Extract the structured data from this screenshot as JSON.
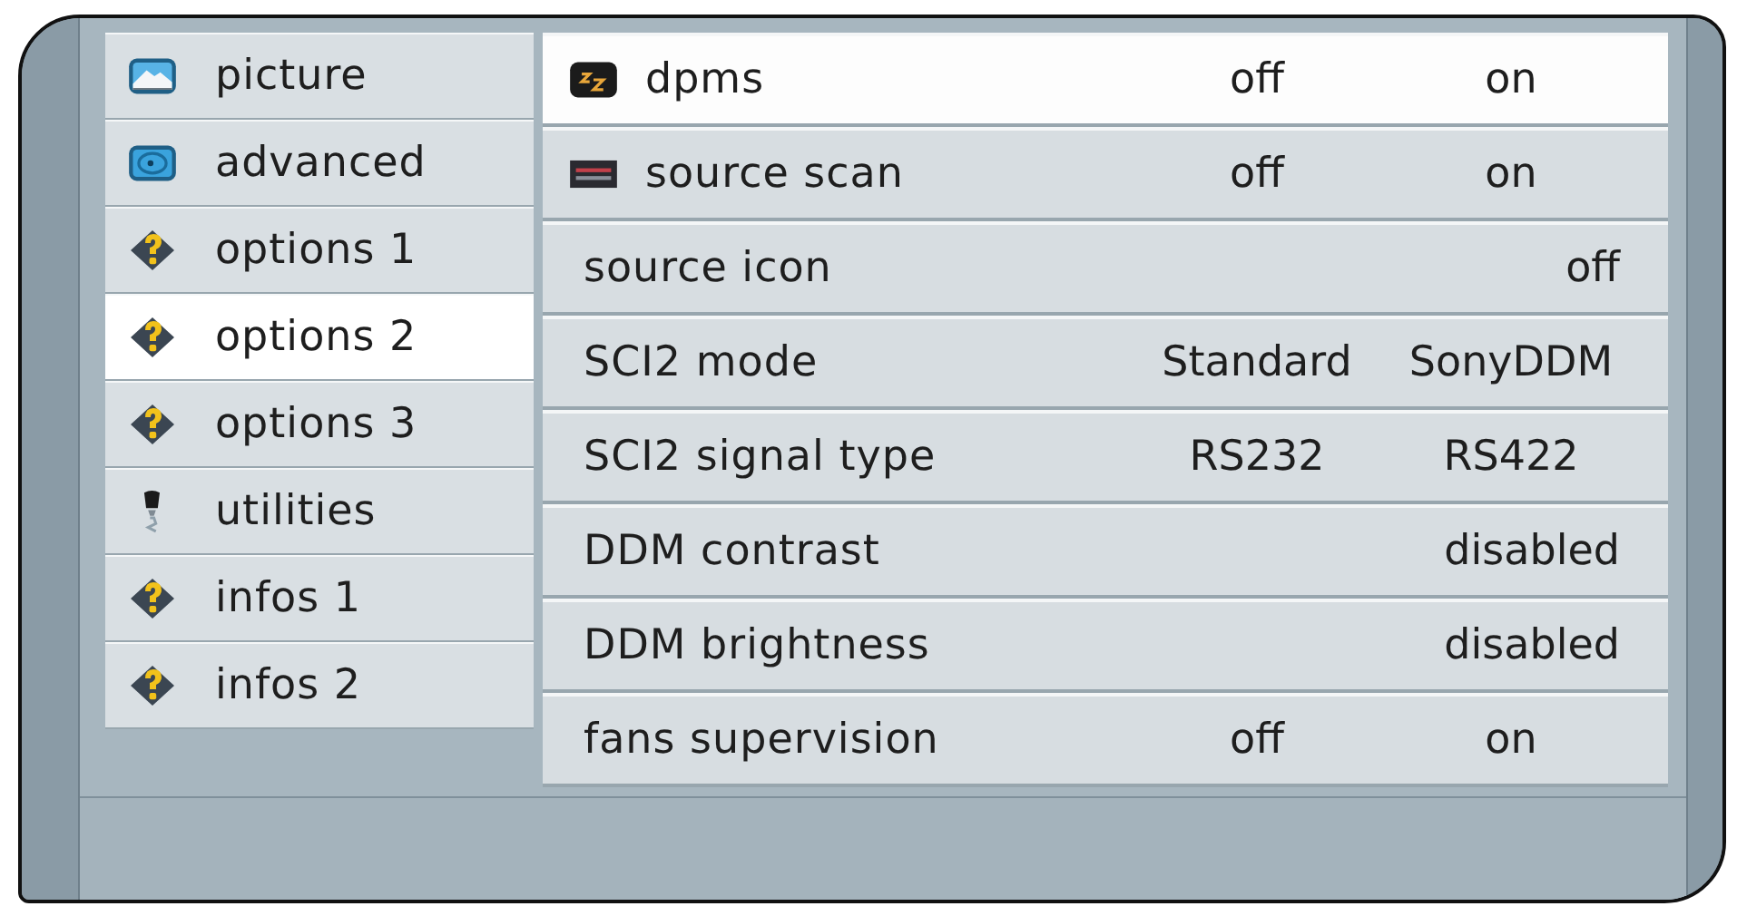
{
  "sidebar": {
    "items": [
      {
        "label": "picture",
        "kind": "picture",
        "selected": false
      },
      {
        "label": "advanced",
        "kind": "advanced",
        "selected": false
      },
      {
        "label": "options 1",
        "kind": "help",
        "selected": false
      },
      {
        "label": "options 2",
        "kind": "help",
        "selected": true
      },
      {
        "label": "options 3",
        "kind": "help",
        "selected": false
      },
      {
        "label": "utilities",
        "kind": "tool",
        "selected": false
      },
      {
        "label": "infos 1",
        "kind": "help",
        "selected": false
      },
      {
        "label": "infos 2",
        "kind": "help",
        "selected": false
      }
    ]
  },
  "settings": {
    "rows": [
      {
        "label": "dpms",
        "kind": "sleep",
        "selected": true,
        "values": [
          "off",
          "on"
        ]
      },
      {
        "label": "source scan",
        "kind": "scan",
        "selected": false,
        "values": [
          "off",
          "on"
        ]
      },
      {
        "label": "source icon",
        "kind": "plain",
        "selected": false,
        "values": [
          "off"
        ]
      },
      {
        "label": "SCI2 mode",
        "kind": "plain",
        "selected": false,
        "values": [
          "Standard",
          "SonyDDM"
        ]
      },
      {
        "label": "SCI2 signal type",
        "kind": "plain",
        "selected": false,
        "values": [
          "RS232",
          "RS422"
        ]
      },
      {
        "label": "DDM contrast",
        "kind": "plain",
        "selected": false,
        "values": [
          "disabled"
        ]
      },
      {
        "label": "DDM brightness",
        "kind": "plain",
        "selected": false,
        "values": [
          "disabled"
        ]
      },
      {
        "label": "fans supervision",
        "kind": "plain",
        "selected": false,
        "values": [
          "off",
          "on"
        ]
      }
    ]
  }
}
